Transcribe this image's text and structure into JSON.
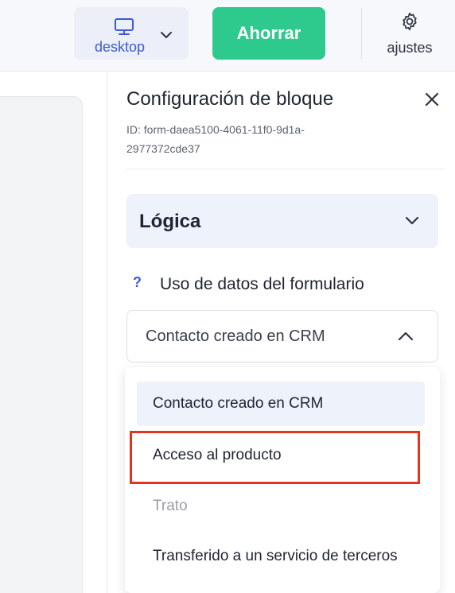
{
  "topbar": {
    "device_label": "desktop",
    "save_label": "Ahorrar",
    "settings_label": "ajustes"
  },
  "panel": {
    "title": "Configuración de bloque",
    "id_text": "ID: form-daea5100-4061-11f0-9d1a-2977372cde37",
    "logic_title": "Lógica",
    "help_glyph": "?",
    "field_label": "Uso de datos del formulario",
    "select_value": "Contacto creado en CRM"
  },
  "dropdown": {
    "options": [
      "Contacto creado en CRM",
      "Acceso al producto",
      "Trato",
      "Transferido a un servicio de terceros"
    ],
    "selected_index": 0,
    "highlighted_index": 1,
    "disabled_index": 2
  },
  "colors": {
    "accent": "#3b5bd6",
    "save": "#2ec98d",
    "highlight": "#e8321e"
  },
  "icons": [
    "monitor-icon",
    "chevron-down-icon",
    "gear-icon",
    "close-icon",
    "chevron-up-icon",
    "help-icon"
  ]
}
